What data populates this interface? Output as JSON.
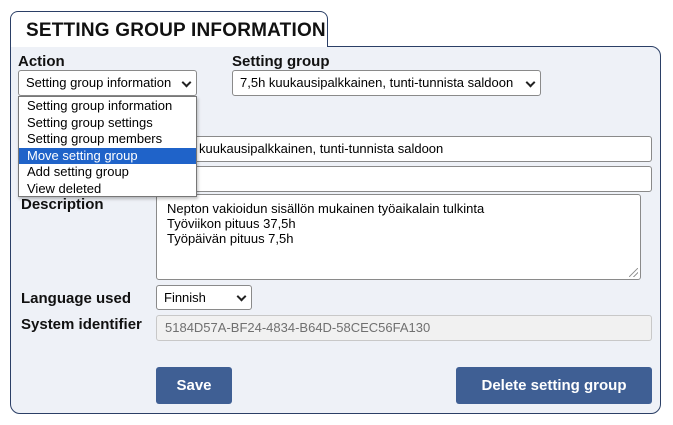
{
  "header": {
    "title": "SETTING GROUP INFORMATION"
  },
  "action": {
    "label": "Action",
    "selected": "Setting group information",
    "options": [
      "Setting group information",
      "Setting group settings",
      "Setting group members",
      "Move setting group",
      "Add setting group",
      "View deleted"
    ],
    "highlighted_index": 3
  },
  "setting_group": {
    "label": "Setting group",
    "selected": "7,5h kuukausipalkkainen, tunti-tunnista saldoon"
  },
  "name": {
    "value": "kuukausipalkkainen, tunti-tunnista saldoon"
  },
  "second_field": {
    "value": ""
  },
  "description": {
    "label": "Description",
    "lines": [
      "Nepton vakioidun sisällön mukainen työaikalain tulkinta",
      "Työviikon pituus 37,5h",
      "Työpäivän pituus 7,5h"
    ]
  },
  "language": {
    "label": "Language used",
    "selected": "Finnish"
  },
  "system_identifier": {
    "label": "System identifier",
    "value": "5184D57A-BF24-4834-B64D-58CEC56FA130"
  },
  "buttons": {
    "save": "Save",
    "delete": "Delete setting group"
  },
  "colors": {
    "accent": "#3f5f94",
    "border": "#2b3f66",
    "panel": "#eef1f7",
    "highlight": "#1f63c9"
  }
}
